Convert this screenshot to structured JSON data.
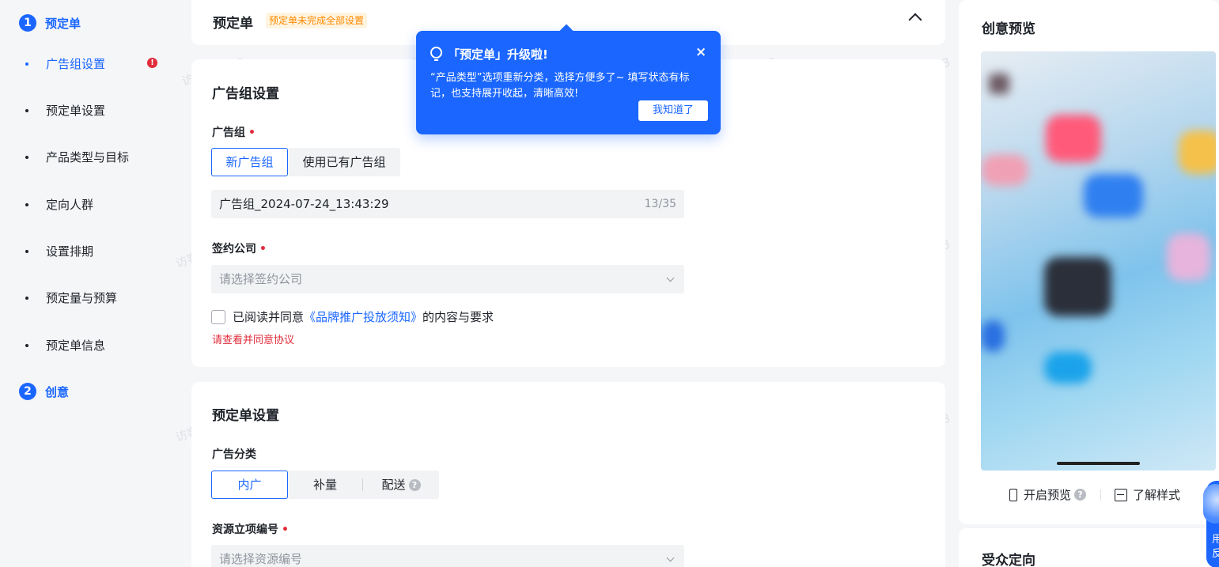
{
  "nav": {
    "step1": {
      "num": "1",
      "label": "预定单"
    },
    "items": [
      {
        "label": "广告组设置",
        "warning": "!"
      },
      {
        "label": "预定单设置"
      },
      {
        "label": "产品类型与目标"
      },
      {
        "label": "定向人群"
      },
      {
        "label": "设置排期"
      },
      {
        "label": "预定量与预算"
      },
      {
        "label": "预定单信息"
      }
    ],
    "step2": {
      "num": "2",
      "label": "创意"
    }
  },
  "header": {
    "title": "预定单",
    "badge": "预定单未完成全部设置"
  },
  "adgroup": {
    "title": "广告组设置",
    "group_label": "广告组",
    "options": [
      "新广告组",
      "使用已有广告组"
    ],
    "name_value": "广告组_2024-07-24_13:43:29",
    "name_counter": "13/35",
    "company_label": "签约公司",
    "company_placeholder": "请选择签约公司",
    "agree_prefix": "已阅读并同意",
    "agree_link": "《品牌推广投放须知》",
    "agree_suffix": "的内容与要求",
    "agree_error": "请查看并同意协议"
  },
  "order": {
    "title": "预定单设置",
    "category_label": "广告分类",
    "category_options": [
      "内广",
      "补量",
      "配送"
    ],
    "resource_label": "资源立项编号",
    "resource_placeholder": "请选择资源编号"
  },
  "tooltip": {
    "title": "「预定单」升级啦!",
    "body": "“产品类型”选项重新分类，选择方便多了~ 填写状态有标记，也支持展开收起，清晰高效!",
    "close": "×",
    "button": "我知道了"
  },
  "preview": {
    "title": "创意预览",
    "open_preview": "开启预览",
    "learn_style": "了解样式"
  },
  "audience": {
    "title": "受众定向"
  },
  "floating": {
    "text": "用反"
  },
  "watermark": "访客 81233",
  "colors": {
    "accent": "#1a66ff",
    "error": "#e22c3b",
    "badge_text": "#ff8a00"
  }
}
